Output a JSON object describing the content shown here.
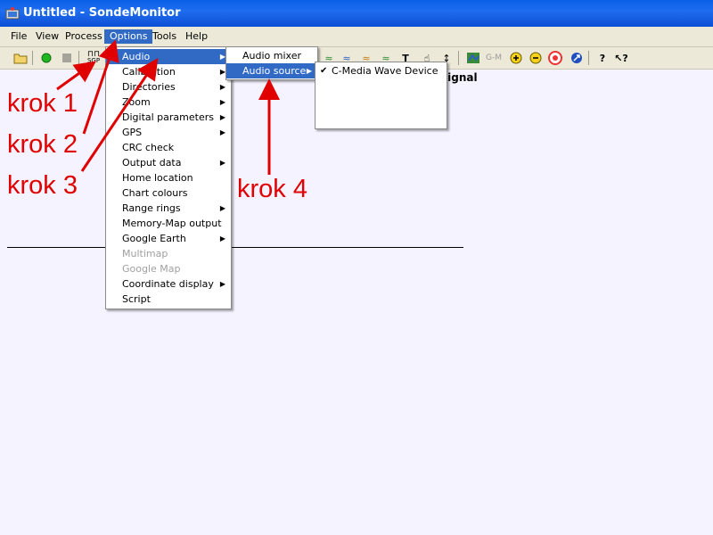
{
  "window": {
    "title": "Untitled - SondeMonitor"
  },
  "menubar": [
    "File",
    "View",
    "Process",
    "Options",
    "Tools",
    "Help"
  ],
  "toolbar": {
    "sgp_label": "SGP",
    "gm_label": "G-M"
  },
  "chart_fragment": "signal",
  "options_menu": [
    "Audio",
    "Calibration",
    "Directories",
    "Zoom",
    "Digital parameters",
    "GPS",
    "CRC check",
    "Output data",
    "Home location",
    "Chart colours",
    "Range rings",
    "Memory-Map output",
    "Google Earth",
    "Multimap",
    "Google Map",
    "Coordinate display",
    "Script"
  ],
  "audio_menu": [
    "Audio mixer",
    "Audio source"
  ],
  "audio_source_menu": [
    "C-Media Wave Device"
  ],
  "annotations": [
    "krok 1",
    "krok 2",
    "krok 3",
    "krok 4"
  ],
  "colors": {
    "selection": "#316ac5",
    "annotation": "#e00000",
    "titlebar": "#0a5fe8"
  }
}
